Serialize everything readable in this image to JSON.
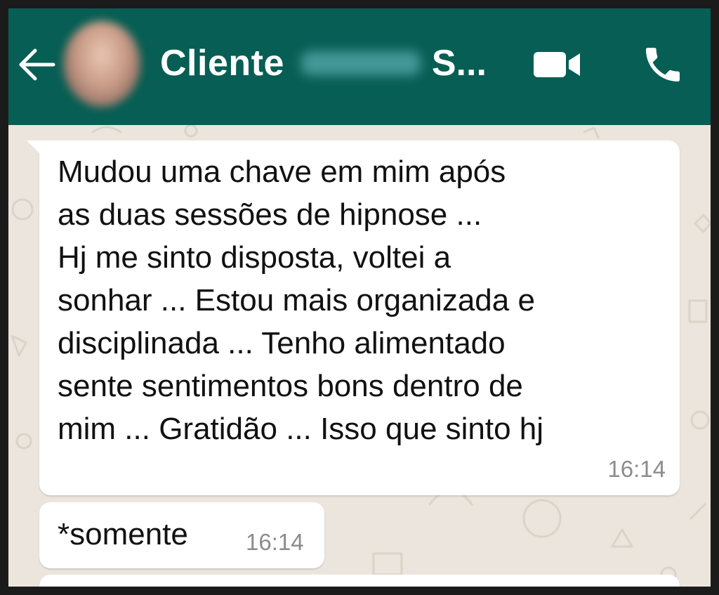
{
  "header": {
    "title_prefix": "Cliente",
    "title_suffix": "S...",
    "back_icon": "back-arrow-icon",
    "video_icon": "videocam-icon",
    "call_icon": "phone-icon",
    "background_color": "#075e54"
  },
  "chat": {
    "background_color": "#ece5dd",
    "bubble_color": "#ffffff",
    "messages": [
      {
        "text": "Mudou uma chave em mim após\nas duas sessões de hipnose ...\nHj me sinto disposta, voltei a\nsonhar ... Estou mais organizada e\ndisciplinada ... Tenho alimentado\nsente sentimentos bons dentro de\nmim ... Gratidão ... Isso que sinto hj",
        "time": "16:14"
      },
      {
        "text": "*somente",
        "time": "16:14"
      }
    ]
  }
}
